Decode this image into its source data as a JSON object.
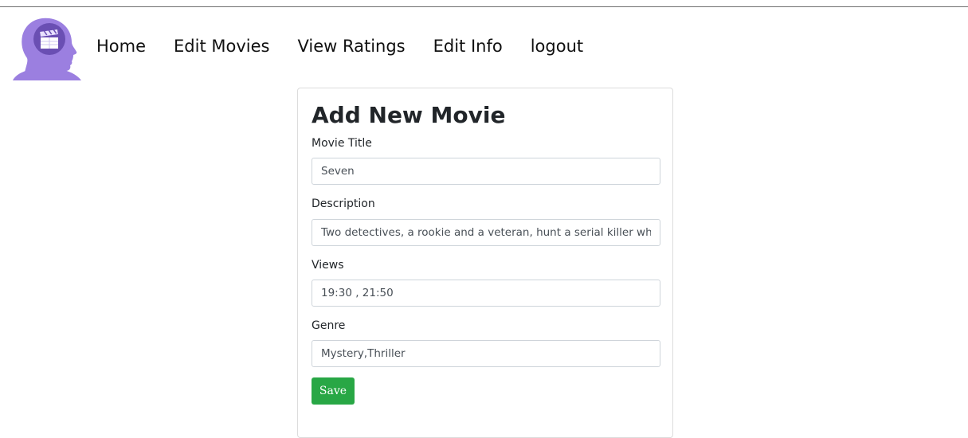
{
  "nav": {
    "items": [
      {
        "label": "Home"
      },
      {
        "label": "Edit Movies"
      },
      {
        "label": "View Ratings"
      },
      {
        "label": "Edit Info"
      },
      {
        "label": "logout"
      }
    ]
  },
  "form": {
    "title": "Add New Movie",
    "fields": [
      {
        "label": "Movie Title",
        "value": "Seven"
      },
      {
        "label": "Description",
        "value": "Two detectives, a rookie and a veteran, hunt a serial killer who uses the seven deadly sins as his motives."
      },
      {
        "label": "Views",
        "value": "19:30 , 21:50"
      },
      {
        "label": "Genre",
        "value": "Mystery,Thriller"
      }
    ],
    "save_label": "Save"
  },
  "colors": {
    "logo_purple": "#9b7fe0",
    "save_green": "#28a745"
  }
}
